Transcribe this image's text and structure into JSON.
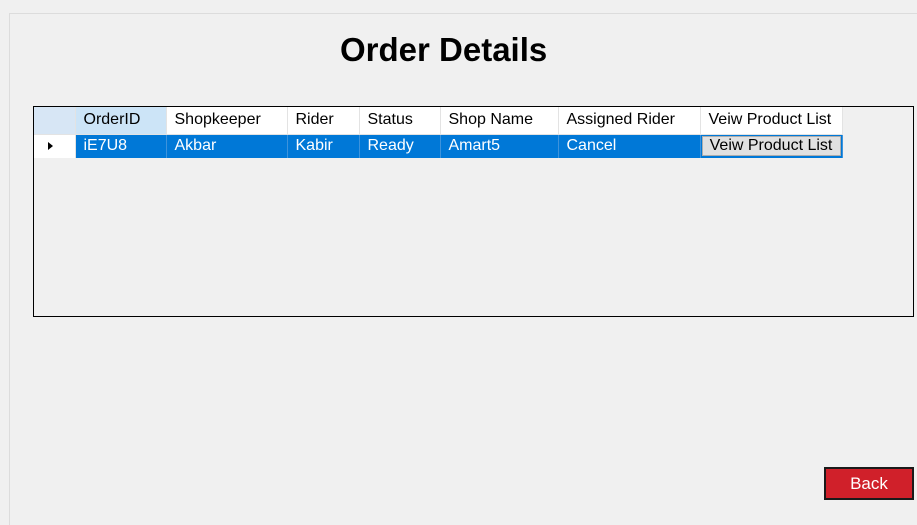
{
  "page": {
    "title": "Order Details"
  },
  "grid": {
    "columns": [
      "OrderID",
      "Shopkeeper",
      "Rider",
      "Status",
      "Shop Name",
      "Assigned Rider",
      "Veiw Product List"
    ],
    "rows": [
      {
        "order_id": "iE7U8",
        "shopkeeper": "Akbar",
        "rider": "Kabir",
        "status": "Ready",
        "shop_name": "Amart5",
        "assigned_rider": "Cancel",
        "product_list_button": "Veiw Product List"
      }
    ]
  },
  "actions": {
    "back_label": "Back"
  },
  "colors": {
    "selection": "#0078d7",
    "back_button": "#d0202a",
    "background": "#f0f0f0"
  }
}
